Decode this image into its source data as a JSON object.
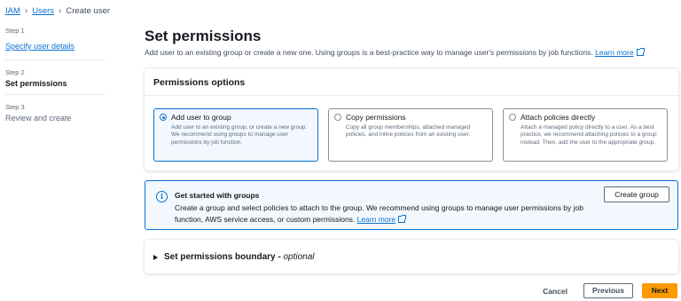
{
  "breadcrumb": {
    "iam": "IAM",
    "users": "Users",
    "current": "Create user"
  },
  "steps": [
    {
      "num": "Step 1",
      "label": "Specify user details"
    },
    {
      "num": "Step 2",
      "label": "Set permissions"
    },
    {
      "num": "Step 3",
      "label": "Review and create"
    }
  ],
  "page": {
    "title": "Set permissions",
    "subtitle": "Add user to an existing group or create a new one. Using groups is a best-practice way to manage user's permissions by job functions.",
    "learn_more": "Learn more"
  },
  "permissions": {
    "header": "Permissions options",
    "options": [
      {
        "label": "Add user to group",
        "desc": "Add user to an existing group, or create a new group. We recommend using groups to manage user permissions by job function.",
        "selected": true
      },
      {
        "label": "Copy permissions",
        "desc": "Copy all group memberships, attached managed policies, and inline policies from an existing user.",
        "selected": false
      },
      {
        "label": "Attach policies directly",
        "desc": "Attach a managed policy directly to a user. As a best practice, we recommend attaching policies to a group instead. Then, add the user to the appropriate group.",
        "selected": false
      }
    ]
  },
  "info": {
    "title": "Get started with groups",
    "text": "Create a group and select policies to attach to the group. We recommend using groups to manage user permissions by job function, AWS service access, or custom permissions.",
    "learn_more": "Learn more",
    "button": "Create group"
  },
  "boundary": {
    "label": "Set permissions boundary - ",
    "optional": "optional"
  },
  "footer": {
    "cancel": "Cancel",
    "previous": "Previous",
    "next": "Next"
  },
  "colors": {
    "accent": "#0972d3",
    "primary_button": "#ff9900"
  }
}
